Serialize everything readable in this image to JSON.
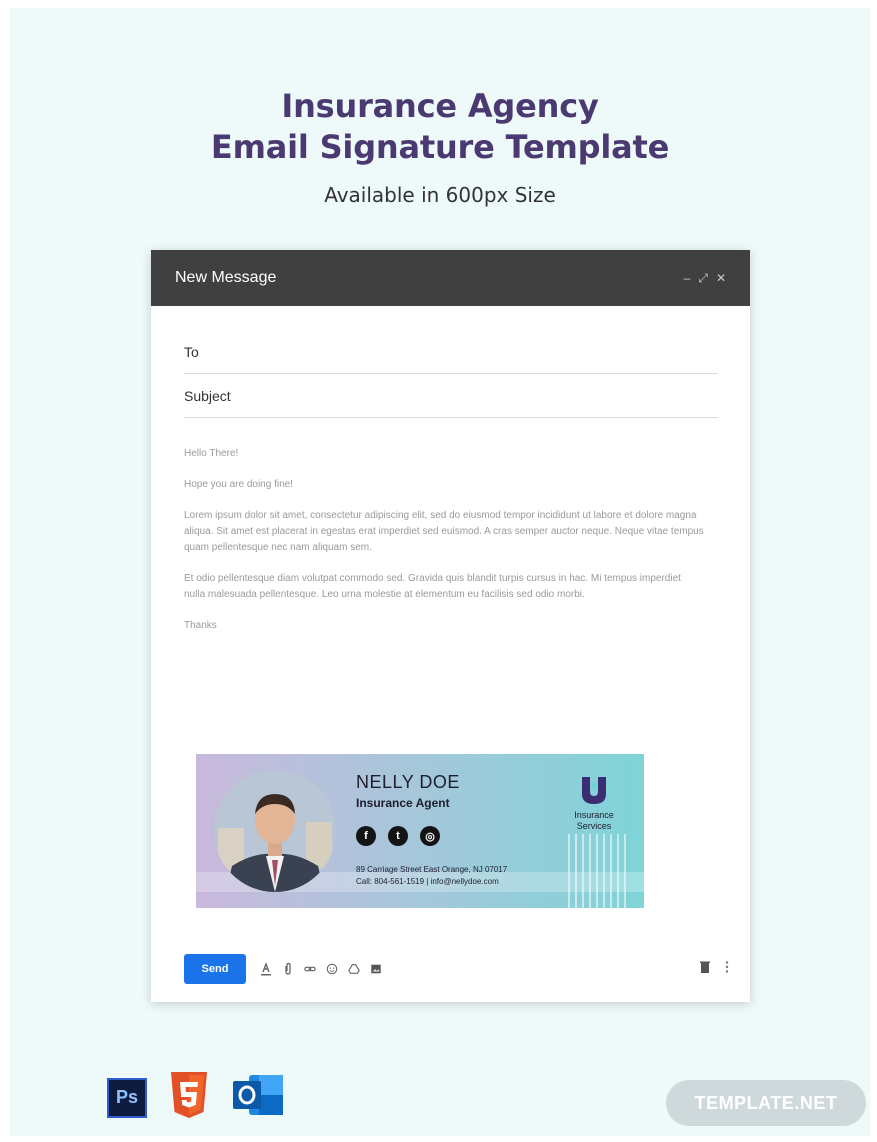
{
  "heading": {
    "line1": "Insurance Agency",
    "line2": "Email Signature Template",
    "sub": "Available in 600px Size"
  },
  "window": {
    "title": "New Message",
    "controls": {
      "minimize": "–",
      "expand": "⤢",
      "close": "✕"
    }
  },
  "fields": {
    "to": "To",
    "subject": "Subject"
  },
  "body": [
    "Hello There!",
    "Hope you are doing fine!",
    "Lorem ipsum dolor sit amet, consectetur adipiscing elit, sed do eiusmod tempor incididunt ut labore et dolore magna aliqua. Sit amet est placerat in egestas erat imperdiet sed euismod. A cras semper auctor neque. Neque vitae tempus quam pellentesque nec nam aliquam sem.",
    "Et odio pellentesque diam volutpat commodo sed. Gravida quis blandit turpis cursus in hac. Mi tempus imperdiet nulla malesuada pellentesque. Leo urna molestie at elementum eu facilisis sed odio morbi.",
    "Thanks"
  ],
  "signature": {
    "name": "NELLY DOE",
    "title": "Insurance Agent",
    "address": "89 Carriage Street East Orange, NJ 07017",
    "contact": "Call: 804-561-1519  |  info@nellydoe.com",
    "logo_line1": "Insurance",
    "logo_line2": "Services",
    "socials": [
      "facebook-icon",
      "twitter-icon",
      "instagram-icon"
    ],
    "social_glyphs": [
      "f",
      "t",
      "◎"
    ]
  },
  "toolbar": {
    "send_label": "Send",
    "tools": [
      "format-text-icon",
      "attach-icon",
      "link-icon",
      "emoji-icon",
      "drive-icon",
      "photo-icon"
    ]
  },
  "apps": [
    "Ps"
  ],
  "brand": "TEMPLATE.NET",
  "colors": {
    "heading": "#4b3a72",
    "titlebar": "#404040",
    "send": "#1a73e8",
    "page_bg": "#eefafa"
  }
}
